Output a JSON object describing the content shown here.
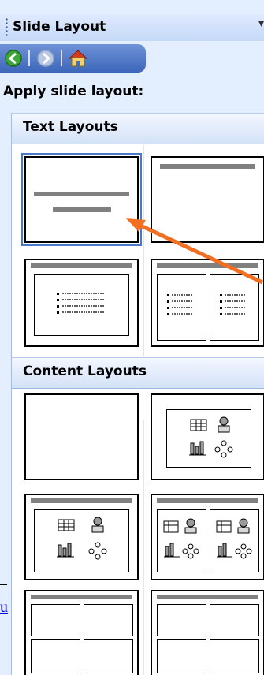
{
  "pane": {
    "title": "Slide Layout",
    "menu_glyph": "▾",
    "apply_label": "Apply slide layout:"
  },
  "nav": {
    "back_icon": "back-arrow-icon",
    "forward_icon": "forward-arrow-icon",
    "home_icon": "home-icon"
  },
  "groups": [
    {
      "label": "Text Layouts"
    },
    {
      "label": "Content Layouts"
    }
  ],
  "layouts": {
    "text": [
      "title-slide",
      "title-only",
      "title-and-text",
      "title-and-two-column-text"
    ],
    "content": [
      "blank",
      "content",
      "title-and-content",
      "title-and-two-content",
      "title-and-four-content",
      "title-and-four-content-alt"
    ]
  },
  "left_edge": {
    "link_fragment": "u"
  },
  "colors": {
    "pane_bg": "#e3efff",
    "nav_bg": "#3c66b9",
    "arrow": "#f26f22",
    "selected_border": "#4b79c9"
  }
}
